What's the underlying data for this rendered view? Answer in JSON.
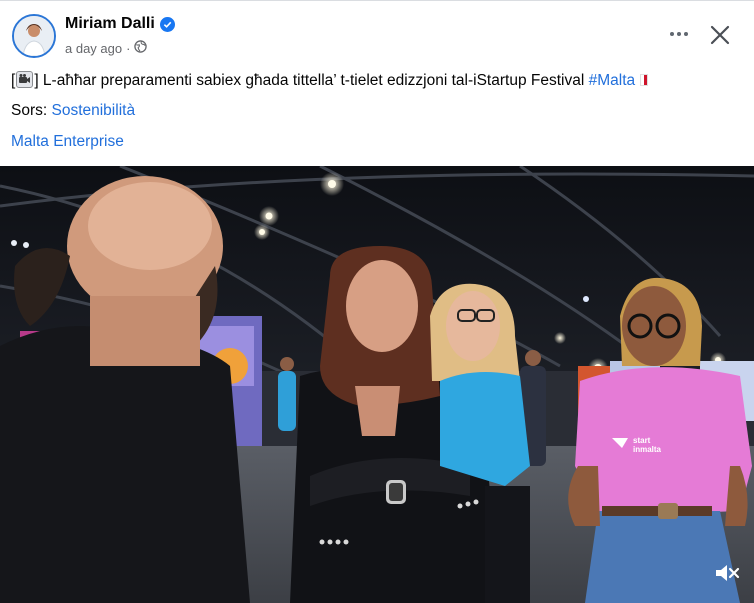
{
  "post": {
    "author": "Miriam Dalli",
    "time": "a day ago",
    "separator": "·",
    "text_bracket_open": "[",
    "text_bracket_close": "]",
    "text_body": " L-aħħar preparamenti sabiex għada tittella’ t-tielet edizzjoni tal-iStartup Festival ",
    "hashtag": "#Malta",
    "source_label": "Sors: ",
    "source_link": "Sostenibilità",
    "org_link": "Malta Enterprise"
  },
  "photo": {
    "shirt_logo_line1": "start",
    "shirt_logo_line2": "inmalta"
  },
  "icons": {
    "verified": "verified-badge-icon",
    "privacy": "globe-icon",
    "more": "more-dots-icon",
    "close": "close-icon",
    "camera": "video-camera-emoji-icon",
    "flag": "malta-flag-icon",
    "mute": "speaker-muted-icon"
  },
  "colors": {
    "link": "#216fdb",
    "verified": "#1877f2",
    "pink_shirt": "#e57bd6",
    "blue_shirt": "#2fa7e0"
  }
}
